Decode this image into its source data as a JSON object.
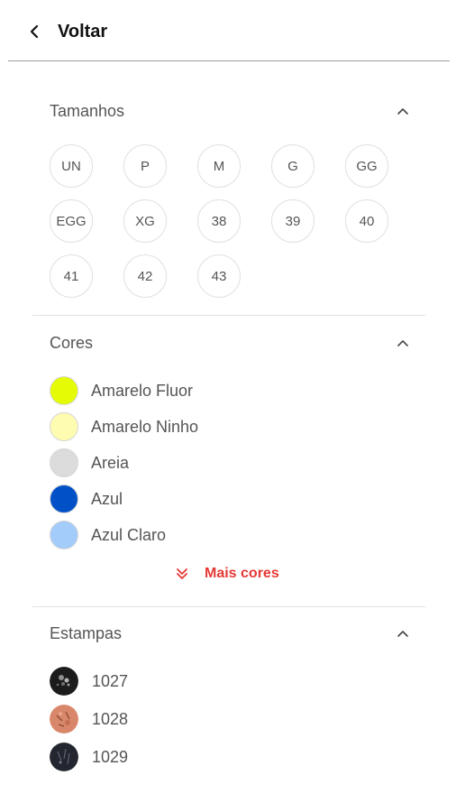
{
  "header": {
    "back_label": "Voltar"
  },
  "sizes": {
    "title": "Tamanhos",
    "items": [
      "UN",
      "P",
      "M",
      "G",
      "GG",
      "EGG",
      "XG",
      "38",
      "39",
      "40",
      "41",
      "42",
      "43"
    ]
  },
  "colors": {
    "title": "Cores",
    "items": [
      {
        "label": "Amarelo Fluor",
        "swatch": "#e4fb05"
      },
      {
        "label": "Amarelo Ninho",
        "swatch": "#fefcb0"
      },
      {
        "label": "Areia",
        "swatch": "#dcdcdc"
      },
      {
        "label": "Azul",
        "swatch": "#0051c8"
      },
      {
        "label": "Azul Claro",
        "swatch": "#a4ccfb"
      }
    ],
    "more_label": "Mais cores",
    "accent": "#e53935"
  },
  "prints": {
    "title": "Estampas",
    "items": [
      {
        "label": "1027"
      },
      {
        "label": "1028"
      },
      {
        "label": "1029"
      }
    ]
  }
}
